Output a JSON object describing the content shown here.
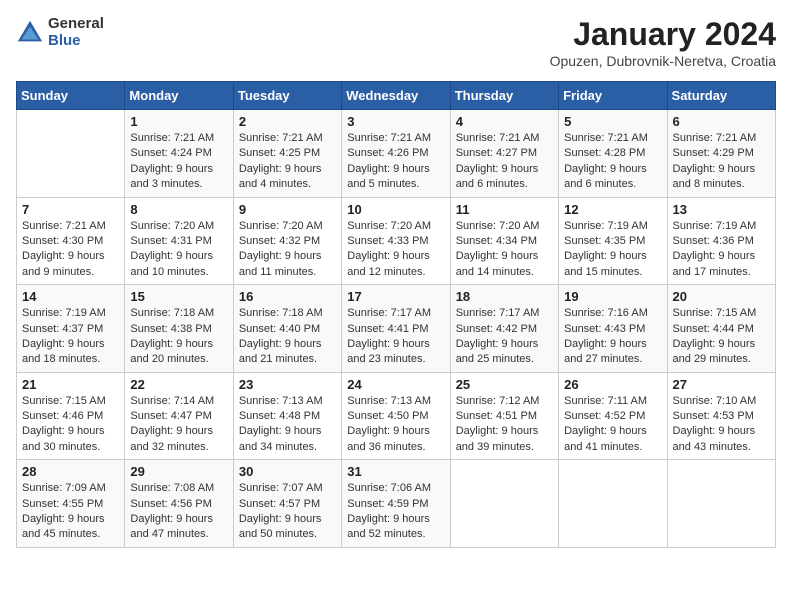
{
  "logo": {
    "general": "General",
    "blue": "Blue"
  },
  "title": "January 2024",
  "subtitle": "Opuzen, Dubrovnik-Neretva, Croatia",
  "days_header": [
    "Sunday",
    "Monday",
    "Tuesday",
    "Wednesday",
    "Thursday",
    "Friday",
    "Saturday"
  ],
  "weeks": [
    [
      {
        "day": "",
        "info": ""
      },
      {
        "day": "1",
        "info": "Sunrise: 7:21 AM\nSunset: 4:24 PM\nDaylight: 9 hours\nand 3 minutes."
      },
      {
        "day": "2",
        "info": "Sunrise: 7:21 AM\nSunset: 4:25 PM\nDaylight: 9 hours\nand 4 minutes."
      },
      {
        "day": "3",
        "info": "Sunrise: 7:21 AM\nSunset: 4:26 PM\nDaylight: 9 hours\nand 5 minutes."
      },
      {
        "day": "4",
        "info": "Sunrise: 7:21 AM\nSunset: 4:27 PM\nDaylight: 9 hours\nand 6 minutes."
      },
      {
        "day": "5",
        "info": "Sunrise: 7:21 AM\nSunset: 4:28 PM\nDaylight: 9 hours\nand 6 minutes."
      },
      {
        "day": "6",
        "info": "Sunrise: 7:21 AM\nSunset: 4:29 PM\nDaylight: 9 hours\nand 8 minutes."
      }
    ],
    [
      {
        "day": "7",
        "info": "Sunrise: 7:21 AM\nSunset: 4:30 PM\nDaylight: 9 hours\nand 9 minutes."
      },
      {
        "day": "8",
        "info": "Sunrise: 7:20 AM\nSunset: 4:31 PM\nDaylight: 9 hours\nand 10 minutes."
      },
      {
        "day": "9",
        "info": "Sunrise: 7:20 AM\nSunset: 4:32 PM\nDaylight: 9 hours\nand 11 minutes."
      },
      {
        "day": "10",
        "info": "Sunrise: 7:20 AM\nSunset: 4:33 PM\nDaylight: 9 hours\nand 12 minutes."
      },
      {
        "day": "11",
        "info": "Sunrise: 7:20 AM\nSunset: 4:34 PM\nDaylight: 9 hours\nand 14 minutes."
      },
      {
        "day": "12",
        "info": "Sunrise: 7:19 AM\nSunset: 4:35 PM\nDaylight: 9 hours\nand 15 minutes."
      },
      {
        "day": "13",
        "info": "Sunrise: 7:19 AM\nSunset: 4:36 PM\nDaylight: 9 hours\nand 17 minutes."
      }
    ],
    [
      {
        "day": "14",
        "info": "Sunrise: 7:19 AM\nSunset: 4:37 PM\nDaylight: 9 hours\nand 18 minutes."
      },
      {
        "day": "15",
        "info": "Sunrise: 7:18 AM\nSunset: 4:38 PM\nDaylight: 9 hours\nand 20 minutes."
      },
      {
        "day": "16",
        "info": "Sunrise: 7:18 AM\nSunset: 4:40 PM\nDaylight: 9 hours\nand 21 minutes."
      },
      {
        "day": "17",
        "info": "Sunrise: 7:17 AM\nSunset: 4:41 PM\nDaylight: 9 hours\nand 23 minutes."
      },
      {
        "day": "18",
        "info": "Sunrise: 7:17 AM\nSunset: 4:42 PM\nDaylight: 9 hours\nand 25 minutes."
      },
      {
        "day": "19",
        "info": "Sunrise: 7:16 AM\nSunset: 4:43 PM\nDaylight: 9 hours\nand 27 minutes."
      },
      {
        "day": "20",
        "info": "Sunrise: 7:15 AM\nSunset: 4:44 PM\nDaylight: 9 hours\nand 29 minutes."
      }
    ],
    [
      {
        "day": "21",
        "info": "Sunrise: 7:15 AM\nSunset: 4:46 PM\nDaylight: 9 hours\nand 30 minutes."
      },
      {
        "day": "22",
        "info": "Sunrise: 7:14 AM\nSunset: 4:47 PM\nDaylight: 9 hours\nand 32 minutes."
      },
      {
        "day": "23",
        "info": "Sunrise: 7:13 AM\nSunset: 4:48 PM\nDaylight: 9 hours\nand 34 minutes."
      },
      {
        "day": "24",
        "info": "Sunrise: 7:13 AM\nSunset: 4:50 PM\nDaylight: 9 hours\nand 36 minutes."
      },
      {
        "day": "25",
        "info": "Sunrise: 7:12 AM\nSunset: 4:51 PM\nDaylight: 9 hours\nand 39 minutes."
      },
      {
        "day": "26",
        "info": "Sunrise: 7:11 AM\nSunset: 4:52 PM\nDaylight: 9 hours\nand 41 minutes."
      },
      {
        "day": "27",
        "info": "Sunrise: 7:10 AM\nSunset: 4:53 PM\nDaylight: 9 hours\nand 43 minutes."
      }
    ],
    [
      {
        "day": "28",
        "info": "Sunrise: 7:09 AM\nSunset: 4:55 PM\nDaylight: 9 hours\nand 45 minutes."
      },
      {
        "day": "29",
        "info": "Sunrise: 7:08 AM\nSunset: 4:56 PM\nDaylight: 9 hours\nand 47 minutes."
      },
      {
        "day": "30",
        "info": "Sunrise: 7:07 AM\nSunset: 4:57 PM\nDaylight: 9 hours\nand 50 minutes."
      },
      {
        "day": "31",
        "info": "Sunrise: 7:06 AM\nSunset: 4:59 PM\nDaylight: 9 hours\nand 52 minutes."
      },
      {
        "day": "",
        "info": ""
      },
      {
        "day": "",
        "info": ""
      },
      {
        "day": "",
        "info": ""
      }
    ]
  ]
}
